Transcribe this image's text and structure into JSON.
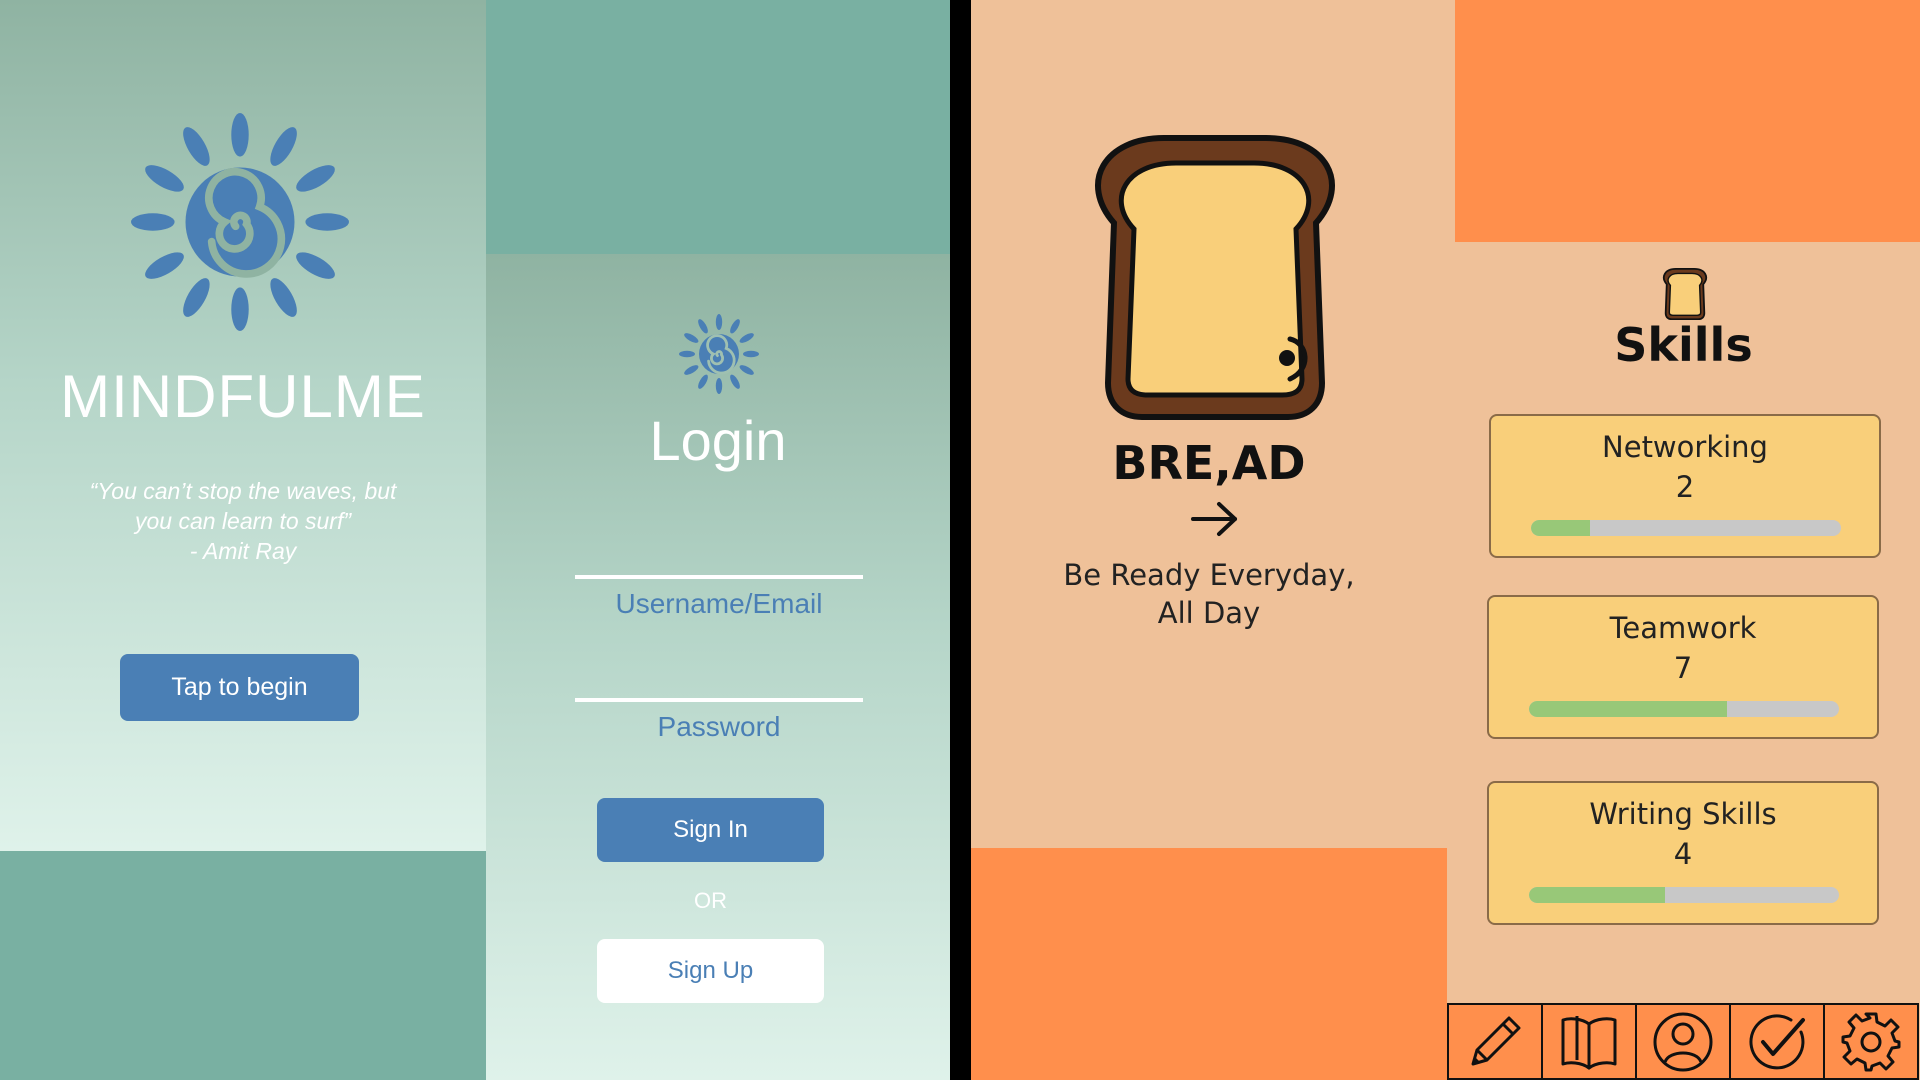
{
  "mindfulme_splash": {
    "app_name": "MINDFULME",
    "quote_line1": "“You can’t stop the waves, but",
    "quote_line2": "you can learn to surf”",
    "quote_author": "- Amit Ray",
    "begin_button": "Tap to begin",
    "logo_icon": "sun-spiral-icon",
    "accent_color": "#4a7fb5"
  },
  "mindfulme_login": {
    "title": "Login",
    "username_label": "Username/Email",
    "password_label": "Password",
    "sign_in_button": "Sign In",
    "or_text": "OR",
    "sign_up_button": "Sign Up",
    "logo_icon": "sun-spiral-icon"
  },
  "bread_splash": {
    "app_name": "BRE,AD",
    "tagline_line1": "Be Ready Everyday,",
    "tagline_line2": "All Day",
    "logo_icon": "toast-icon",
    "arrow_icon": "arrow-right-icon"
  },
  "bread_skills": {
    "title": "Skills",
    "title_icon": "toast-icon",
    "skills": [
      {
        "name": "Networking",
        "level": "2",
        "progress": 0.19
      },
      {
        "name": "Teamwork",
        "level": "7",
        "progress": 0.64
      },
      {
        "name": "Writing Skills",
        "level": "4",
        "progress": 0.44
      }
    ],
    "nav_items": [
      "pencil-icon",
      "book-icon",
      "profile-icon",
      "check-icon",
      "gear-icon"
    ],
    "colors": {
      "orange": "#ff8f4c",
      "peach": "#efc199",
      "card": "#f9cf7a",
      "progress": "#98c878"
    }
  }
}
